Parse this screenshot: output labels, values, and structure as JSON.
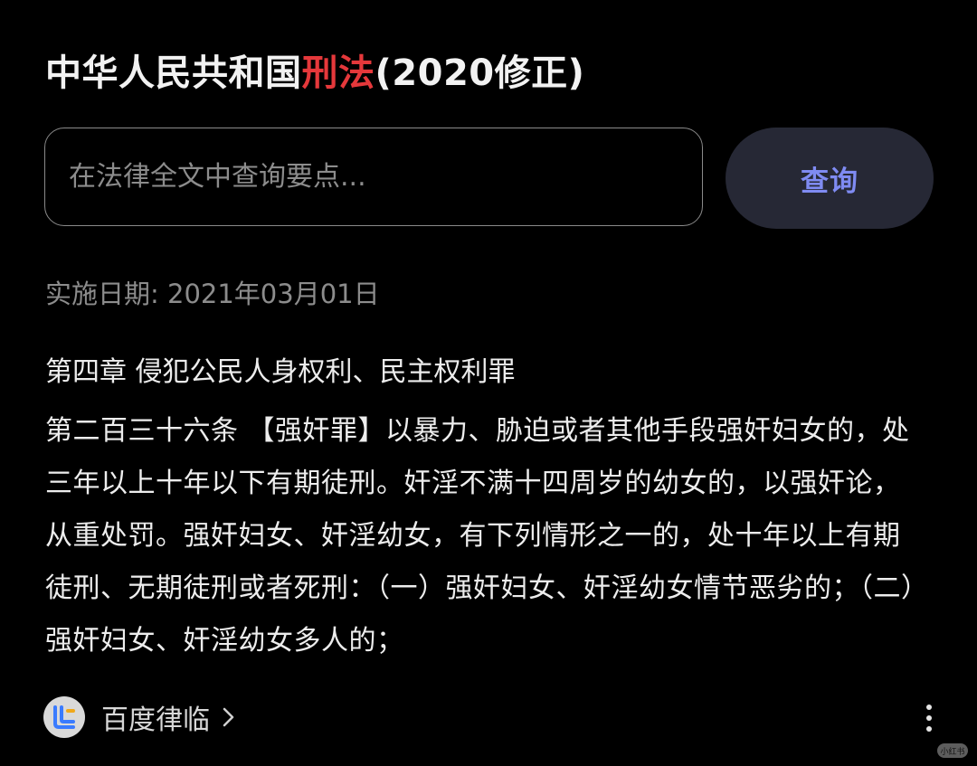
{
  "header": {
    "title_before": "中华人民共和国",
    "title_highlight": "刑法",
    "title_after": "(2020修正)",
    "highlight_color": "#e5383b"
  },
  "search": {
    "placeholder": "在法律全文中查询要点...",
    "value": "",
    "button_label": "查询",
    "button_color": "#7f8bf2"
  },
  "effective_date": "实施日期: 2021年03月01日",
  "chapter": "第四章 侵犯公民人身权利、民主权利罪",
  "article": "第二百三十六条 【强奸罪】以暴力、胁迫或者其他手段强奸妇女的，处三年以上十年以下有期徒刑。奸淫不满十四周岁的幼女的，以强奸论，从重处罚。强奸妇女、奸淫幼女，有下列情形之一的，处十年以上有期徒刑、无期徒刑或者死刑：（一）强奸妇女、奸淫幼女情节恶劣的；（二）强奸妇女、奸淫幼女多人的；",
  "source": {
    "name": "百度律临",
    "logo_icon": "baidu-lvlin-logo-icon",
    "chevron_icon": "chevron-right-icon"
  },
  "menu": {
    "icon": "more-vertical-icon"
  },
  "watermark": {
    "text": "小红书"
  }
}
